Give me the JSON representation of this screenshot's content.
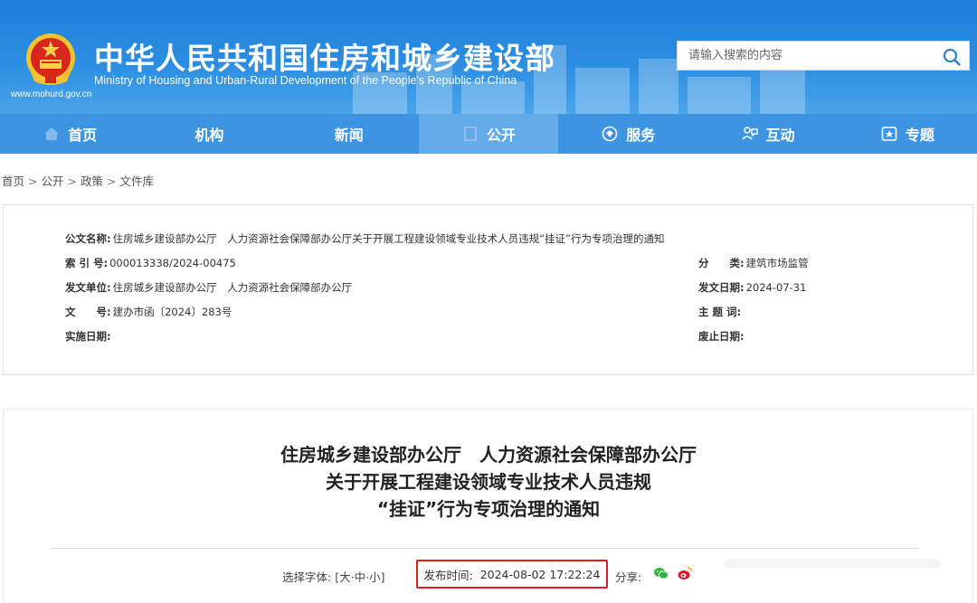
{
  "header": {
    "title": "中华人民共和国住房和城乡建设部",
    "subtitle": "Ministry of Housing and Urban-Rural Development of the People's Republic of China",
    "url": "www.mohurd.gov.cn",
    "emblem_icon": "national-emblem-icon",
    "search": {
      "placeholder": "请输入搜索的内容",
      "button_icon": "search-icon"
    }
  },
  "nav": {
    "items": [
      {
        "label": "首页",
        "icon": "home-icon"
      },
      {
        "label": "机构",
        "icon": ""
      },
      {
        "label": "新闻",
        "icon": ""
      },
      {
        "label": "公开",
        "icon": "public-icon",
        "active": true
      },
      {
        "label": "服务",
        "icon": "service-icon"
      },
      {
        "label": "互动",
        "icon": "interaction-icon"
      },
      {
        "label": "专题",
        "icon": "topic-icon"
      }
    ]
  },
  "breadcrumb": [
    "首页",
    "公开",
    "政策",
    "文件库"
  ],
  "meta": {
    "doc_name_label": "公文名称:",
    "doc_name": "住房城乡建设部办公厅　人力资源社会保障部办公厅关于开展工程建设领域专业技术人员违规“挂证”行为专项治理的通知",
    "index_label": "索 引 号:",
    "index": "000013338/2024-00475",
    "category_label": "分　　类:",
    "category": "建筑市场监管",
    "issuer_label": "发文单位:",
    "issuer": "住房城乡建设部办公厅　人力资源社会保障部办公厅",
    "issue_date_label": "发文日期:",
    "issue_date": "2024-07-31",
    "doc_no_label": "文　　号:",
    "doc_no": "建办市函〔2024〕283号",
    "subject_label": "主 题 词:",
    "subject": "",
    "effective_label": "实施日期:",
    "effective": "",
    "expiry_label": "废止日期:",
    "expiry": ""
  },
  "document": {
    "title_lines": [
      "住房城乡建设部办公厅　人力资源社会保障部办公厅",
      "关于开展工程建设领域专业技术人员违规",
      "“挂证”行为专项治理的通知"
    ],
    "font_select_label": "选择字体:",
    "font_sizes": [
      "[",
      "大",
      "·",
      "中",
      "·",
      "小",
      "]"
    ],
    "publish_time_label": "发布时间:",
    "publish_time": "2024-08-02 17:22:24",
    "share_label": "分享:",
    "share_icons": [
      "wechat-icon",
      "weibo-icon"
    ]
  },
  "colors": {
    "header_blue": "#2b8de2",
    "nav_blue": "#3d94e0",
    "nav_active": "#62aae8",
    "highlight_red": "#e02020"
  }
}
